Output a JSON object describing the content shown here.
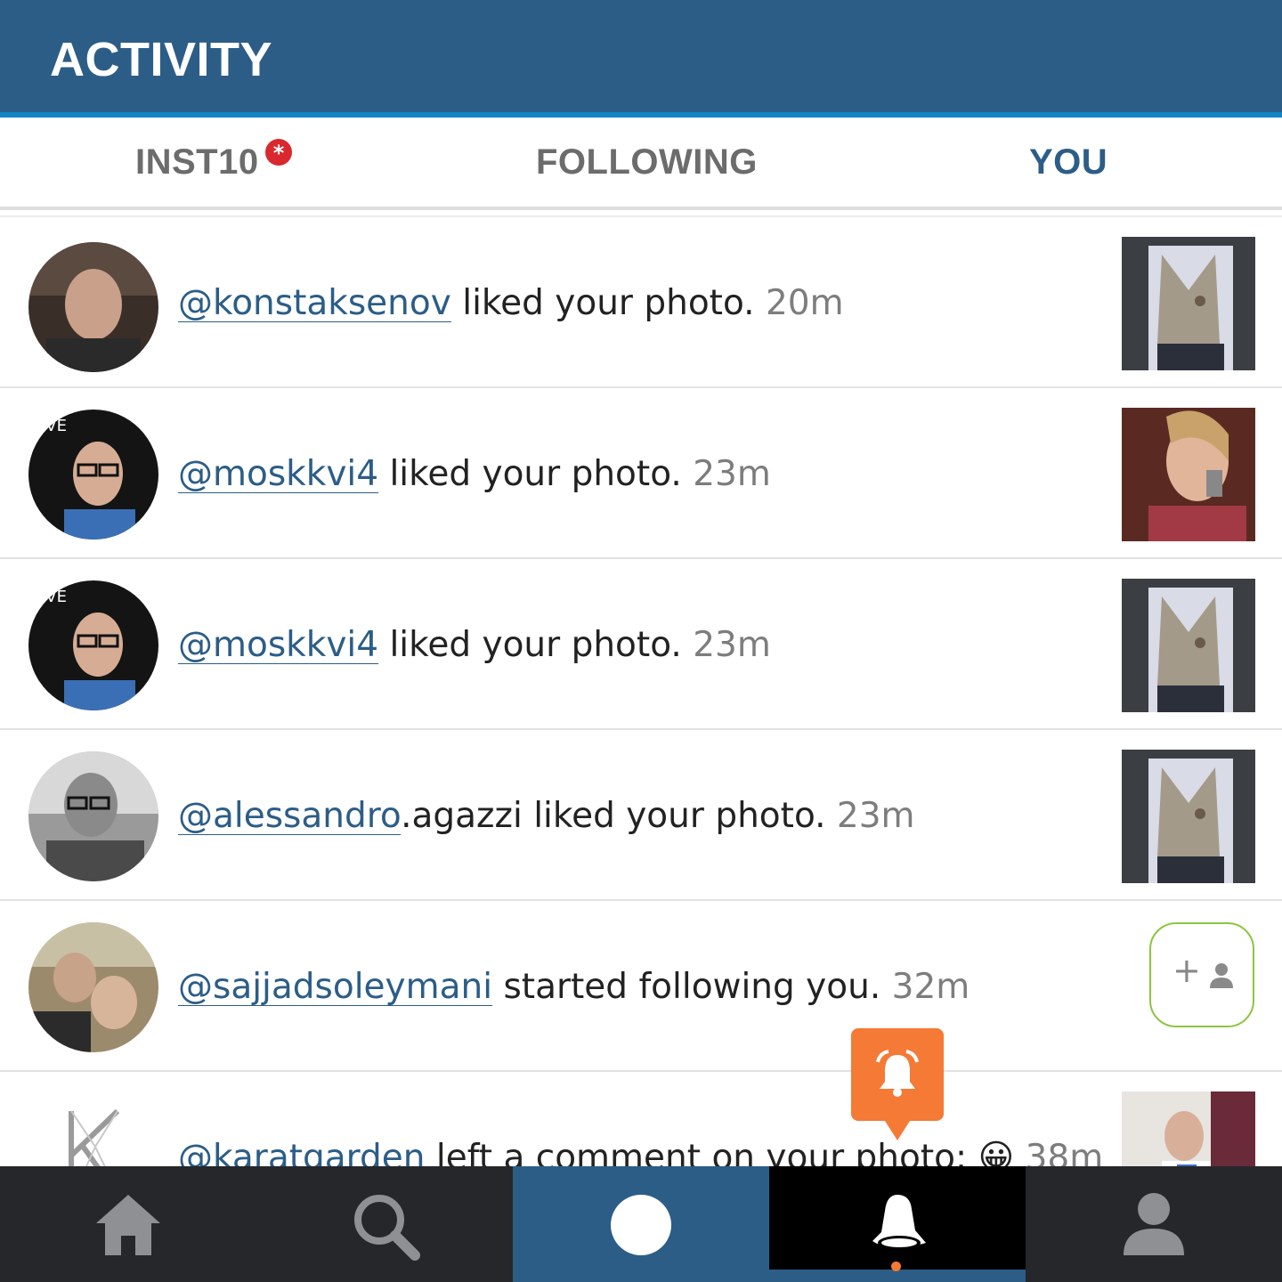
{
  "header": {
    "title": "ACTIVITY"
  },
  "tabs": [
    {
      "label": "INST10",
      "badge": "*",
      "active": false
    },
    {
      "label": "FOLLOWING",
      "active": false
    },
    {
      "label": "YOU",
      "active": true
    }
  ],
  "activity": [
    {
      "handle": "@konstaksenov",
      "text": " liked your photo. ",
      "time": "20m",
      "action": "like"
    },
    {
      "handle": "@moskkvi4",
      "text": " liked your photo. ",
      "time": "23m",
      "action": "like"
    },
    {
      "handle": "@moskkvi4",
      "text": " liked your photo. ",
      "time": "23m",
      "action": "like"
    },
    {
      "handle": "@alessandro",
      "text": ".agazzi liked your photo. ",
      "time": "23m",
      "action": "like"
    },
    {
      "handle": "@sajjadsoleymani",
      "text": " started following you. ",
      "time": "32m",
      "action": "follow",
      "button_label": "+"
    },
    {
      "handle": "@karatgarden",
      "text": " left a comment on your photo: ",
      "emoji": "😀",
      "time": "38m",
      "action": "comment"
    }
  ],
  "nav": [
    {
      "name": "home",
      "icon": "home-icon"
    },
    {
      "name": "search",
      "icon": "search-icon"
    },
    {
      "name": "camera",
      "icon": "camera-icon"
    },
    {
      "name": "activity",
      "icon": "bell-icon",
      "active": true
    },
    {
      "name": "profile",
      "icon": "profile-icon"
    }
  ],
  "colors": {
    "header": "#2c5d87",
    "accent": "#1086c4",
    "link": "#2c5d87",
    "notification": "#f47a36",
    "follow_border": "#8cc63f",
    "nav_bg": "#25272b"
  }
}
